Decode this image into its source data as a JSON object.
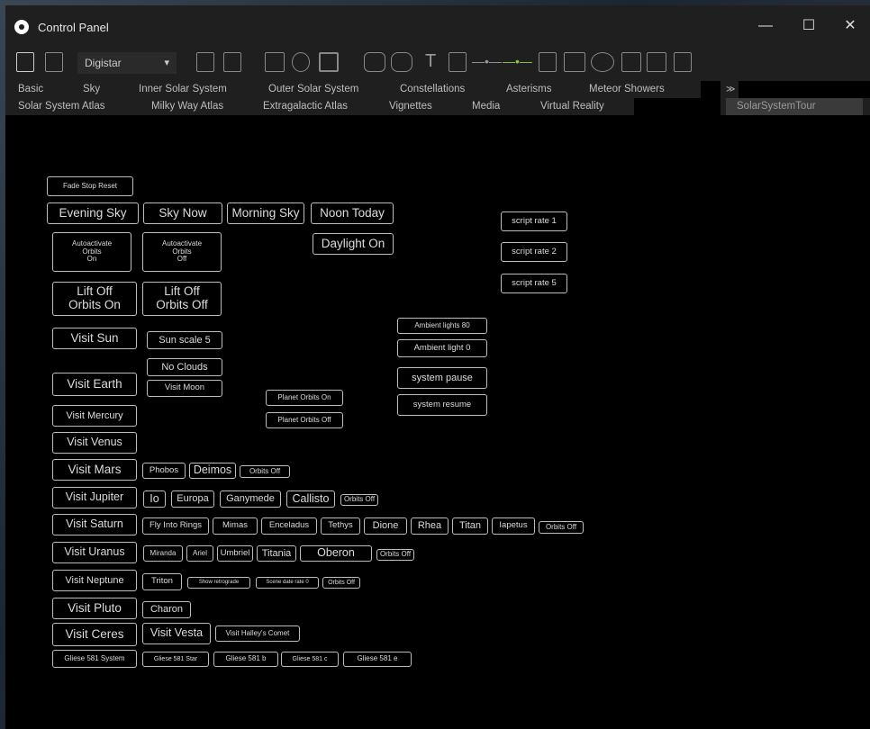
{
  "window": {
    "title": "Control Panel",
    "controls": {
      "minimize": "—",
      "maximize": "☐",
      "close": "✕"
    }
  },
  "toolbar": {
    "preset": "Digistar",
    "chevron": "▾",
    "glyph_text": "T",
    "glyph_line": "—•—",
    "glyph_line_accent": "—•—",
    "accent_color": "#8dc63f"
  },
  "tabs": {
    "row1": [
      "Basic",
      "Sky",
      "Inner Solar System",
      "Outer Solar System",
      "Constellations",
      "Asterisms",
      "Meteor Showers"
    ],
    "row2": [
      "Solar System Atlas",
      "Milky Way Atlas",
      "Extragalactic Atlas",
      "Vignettes",
      "Media",
      "Virtual Reality"
    ],
    "collapse": "≫",
    "selected": "SolarSystemTour"
  },
  "buttons": {
    "fade_stop_reset": "Fade Stop Reset",
    "evening_sky": "Evening Sky",
    "sky_now": "Sky Now",
    "morning_sky": "Morning Sky",
    "noon_today": "Noon Today",
    "daylight_on": "Daylight On",
    "autoactivate_on": "Autoactivate\nOrbits\nOn",
    "autoactivate_off": "Autoactivate\nOrbits\nOff",
    "liftoff_on": "Lift Off\nOrbits On",
    "liftoff_off": "Lift Off\nOrbits Off",
    "visit_sun": "Visit Sun",
    "sun_scale": "Sun scale 5",
    "no_clouds": "No Clouds",
    "visit_earth": "Visit  Earth",
    "visit_moon": "Visit Moon",
    "planet_orbits_on": "Planet Orbits On",
    "planet_orbits_off": "Planet Orbits Off",
    "visit_mercury": "Visit Mercury",
    "visit_venus": "Visit Venus",
    "visit_mars": "Visit  Mars",
    "phobos": "Phobos",
    "deimos": "Deimos",
    "mars_orbits_off": "Orbits Off",
    "visit_jupiter": "Visit Jupiter",
    "io": "Io",
    "europa": "Europa",
    "ganymede": "Ganymede",
    "callisto": "Callisto",
    "jupiter_orbits_off": "Orbits Off",
    "visit_saturn": "Visit Saturn",
    "fly_into_rings": "Fly Into Rings",
    "mimas": "Mimas",
    "enceladus": "Enceladus",
    "tethys": "Tethys",
    "dione": "Dione",
    "rhea": "Rhea",
    "titan": "Titan",
    "iapetus": "Iapetus",
    "saturn_orbits_off": "Orbits Off",
    "visit_uranus": "Visit Uranus",
    "miranda": "Miranda",
    "ariel": "Ariel",
    "umbriel": "Umbriel",
    "titania": "Titania",
    "oberon": "Oberon",
    "uranus_orbits_off": "Orbits Off",
    "visit_neptune": "Visit Neptune",
    "triton": "Triton",
    "show_retrograde": "Show retrograde",
    "scene_date_rate": "Scene date rate 0",
    "neptune_orbits_off": "Orbits Off",
    "visit_pluto": "Visit Pluto",
    "charon": "Charon",
    "visit_ceres": "Visit Ceres",
    "visit_vesta": "Visit Vesta",
    "visit_halley": "Visit Halley's Comet",
    "gliese_system": "Gliese 581 System",
    "gliese_star": "Gliese 581 Star",
    "gliese_b": "Gliese 581 b",
    "gliese_c": "Gliese 581 c",
    "gliese_e": "Gliese 581 e",
    "script_rate_1": "script rate 1",
    "script_rate_2": "script rate 2",
    "script_rate_5": "script rate 5",
    "ambient_80": "Ambient lights 80",
    "ambient_0": "Ambient light 0",
    "system_pause": "system pause",
    "system_resume": "system resume"
  }
}
